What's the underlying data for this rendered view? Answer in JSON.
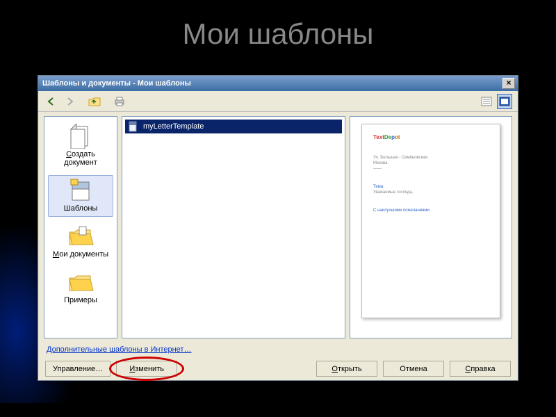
{
  "slide": {
    "title": "Мои шаблоны"
  },
  "dialog": {
    "title": "Шаблоны и документы - Мои шаблоны",
    "close": "×"
  },
  "toolbar": {
    "back": "←",
    "forward": "→"
  },
  "sidebar": {
    "items": [
      {
        "label": "Создать документ",
        "name": "new-document"
      },
      {
        "label": "Шаблоны",
        "name": "templates",
        "selected": true
      },
      {
        "label": "Мои документы",
        "name": "my-documents"
      },
      {
        "label": "Примеры",
        "name": "samples"
      }
    ]
  },
  "list": {
    "items": [
      {
        "label": "myLetterTemplate",
        "selected": true
      }
    ]
  },
  "preview": {
    "logo_parts": [
      "Text",
      "De",
      "p",
      "ot"
    ],
    "lines": [
      "Ул. Большая - Семёновская",
      "Москва",
      "——"
    ],
    "body1": "Тема:",
    "body2": "Уважаемые господа,",
    "body3": "С наилучшими пожеланиями"
  },
  "link": {
    "label": "Дополнительные шаблоны в Интернет…"
  },
  "buttons": {
    "manage": "Управление…",
    "edit": "Изменить",
    "open": "Открыть",
    "cancel": "Отмена",
    "help": "Справка"
  }
}
